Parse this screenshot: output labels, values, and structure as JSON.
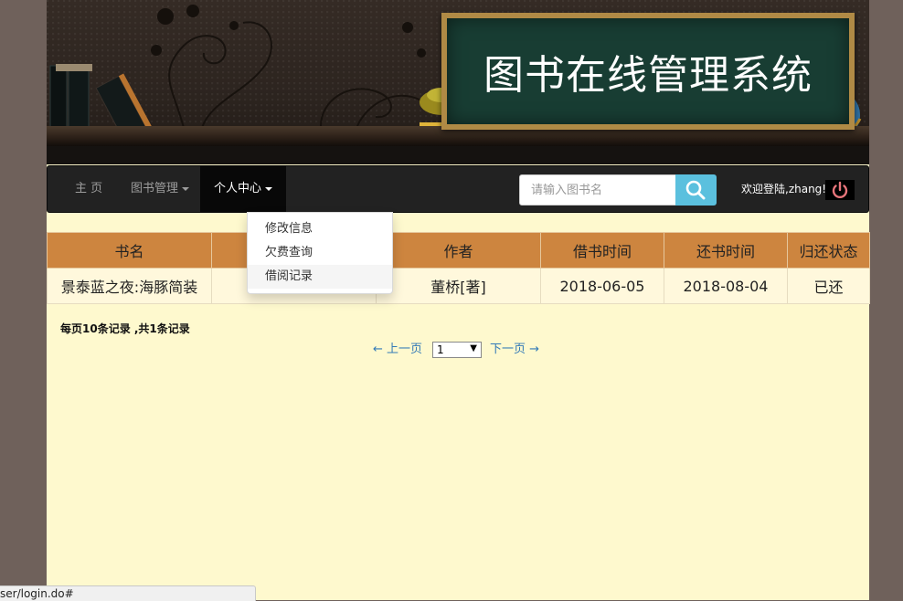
{
  "banner": {
    "title": "图书在线管理系统"
  },
  "navbar": {
    "home_label": "主 页",
    "book_mgmt_label": "图书管理",
    "personal_label": "个人中心",
    "search_placeholder": "请输入图书名",
    "welcome_text": "欢迎登陆,zhang!"
  },
  "dropdown": {
    "items": [
      {
        "label": "修改信息"
      },
      {
        "label": "欠费查询"
      },
      {
        "label": "借阅记录"
      }
    ]
  },
  "table": {
    "headers": [
      "书名",
      "作者",
      "借书时间",
      "还书时间",
      "归还状态"
    ],
    "rows": [
      {
        "title": "景泰蓝之夜:海豚简装",
        "author": "董桥[著]",
        "borrow_date": "2018-06-05",
        "return_date": "2018-08-04",
        "status": "已还"
      }
    ]
  },
  "record_info": "每页10条记录 ,共1条记录",
  "pager": {
    "prev_label": "← 上一页",
    "page_value": "1",
    "next_label": "下一页 →"
  },
  "statusbar": {
    "url": "ser/login.do#"
  },
  "colors": {
    "page_bg": "#fef9ce",
    "outer_bg": "#6f615b",
    "table_header": "#cd853f",
    "table_row": "#fff8dc",
    "blackboard": "#183d33",
    "search_button": "#5bc0de",
    "power_icon": "#e8757b",
    "link": "#337ab7"
  }
}
